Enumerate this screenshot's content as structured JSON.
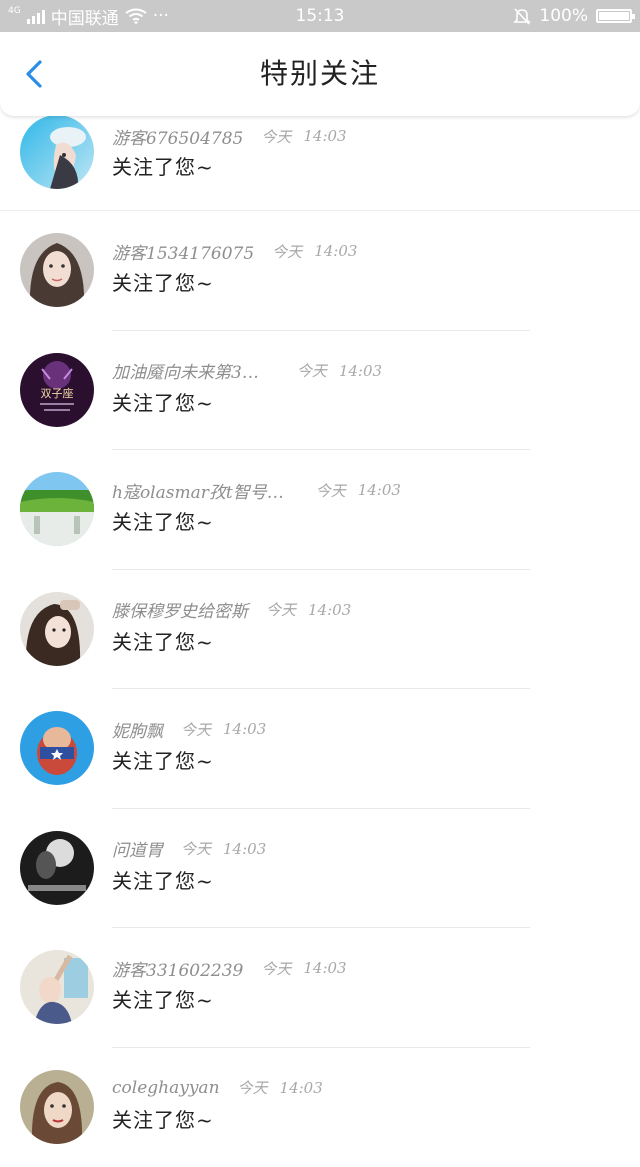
{
  "status_bar": {
    "network_badge": "4G",
    "carrier": "中国联通",
    "more": "···",
    "time": "15:13",
    "battery": "100%",
    "battery_level": 1.0
  },
  "nav": {
    "title": "特别关注",
    "back_icon": "chevron-left-icon"
  },
  "notifications": [
    {
      "name": "游客676504785",
      "day": "今天",
      "time": "14:03",
      "message": "关注了您~"
    },
    {
      "name": "游客1534176075",
      "day": "今天",
      "time": "14:03",
      "message": "关注了您~"
    },
    {
      "name": "加油魇向未来第3…",
      "day": "今天",
      "time": "14:03",
      "message": "关注了您~",
      "avatar_text": "双子座"
    },
    {
      "name": "h寇olasmar孜t智号…",
      "day": "今天",
      "time": "14:03",
      "message": "关注了您~"
    },
    {
      "name": "滕保穆罗史给密斯",
      "day": "今天",
      "time": "14:03",
      "message": "关注了您~"
    },
    {
      "name": "妮朐飘",
      "day": "今天",
      "time": "14:03",
      "message": "关注了您~"
    },
    {
      "name": "问道胃",
      "day": "今天",
      "time": "14:03",
      "message": "关注了您~"
    },
    {
      "name": "游客331602239",
      "day": "今天",
      "time": "14:03",
      "message": "关注了您~"
    },
    {
      "name": "coleghayyan",
      "day": "今天",
      "time": "14:03",
      "message": "关注了您~"
    }
  ]
}
